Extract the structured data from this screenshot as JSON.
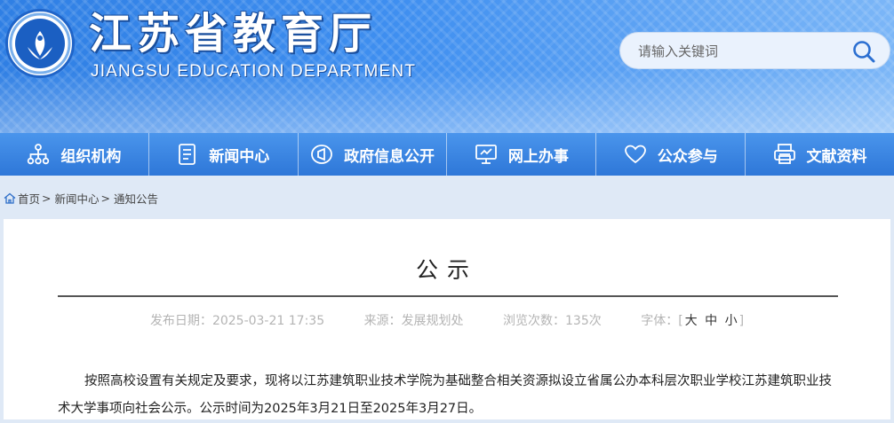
{
  "site": {
    "title": "江苏省教育厅",
    "subtitle": "JIANGSU EDUCATION DEPARTMENT"
  },
  "search": {
    "placeholder": "请输入关键词"
  },
  "nav": [
    {
      "label": "组织机构",
      "icon": "org-chart-icon"
    },
    {
      "label": "新闻中心",
      "icon": "document-icon"
    },
    {
      "label": "政府信息公开",
      "icon": "megaphone-icon"
    },
    {
      "label": "网上办事",
      "icon": "monitor-icon"
    },
    {
      "label": "公众参与",
      "icon": "heart-icon"
    },
    {
      "label": "文献资料",
      "icon": "printer-icon"
    }
  ],
  "breadcrumb": {
    "home": "首页",
    "section": "新闻中心",
    "current": "通知公告",
    "separator": ">"
  },
  "article": {
    "title": "公示",
    "meta": {
      "date_label": "发布日期：",
      "date": "2025-03-21 17:35",
      "source_label": "来源：",
      "source": "发展规划处",
      "views_label": "浏览次数：",
      "views": "135次",
      "font_label": "字体：",
      "font_open": "[",
      "font_large": "大",
      "font_medium": "中",
      "font_small": "小",
      "font_close": "]"
    },
    "paragraph": "按照高校设置有关规定及要求，现将以江苏建筑职业技术学院为基础整合相关资源拟设立省属公办本科层次职业学校江苏建筑职业技术大学事项向社会公示。公示时间为2025年3月21日至2025年3月27日。"
  }
}
